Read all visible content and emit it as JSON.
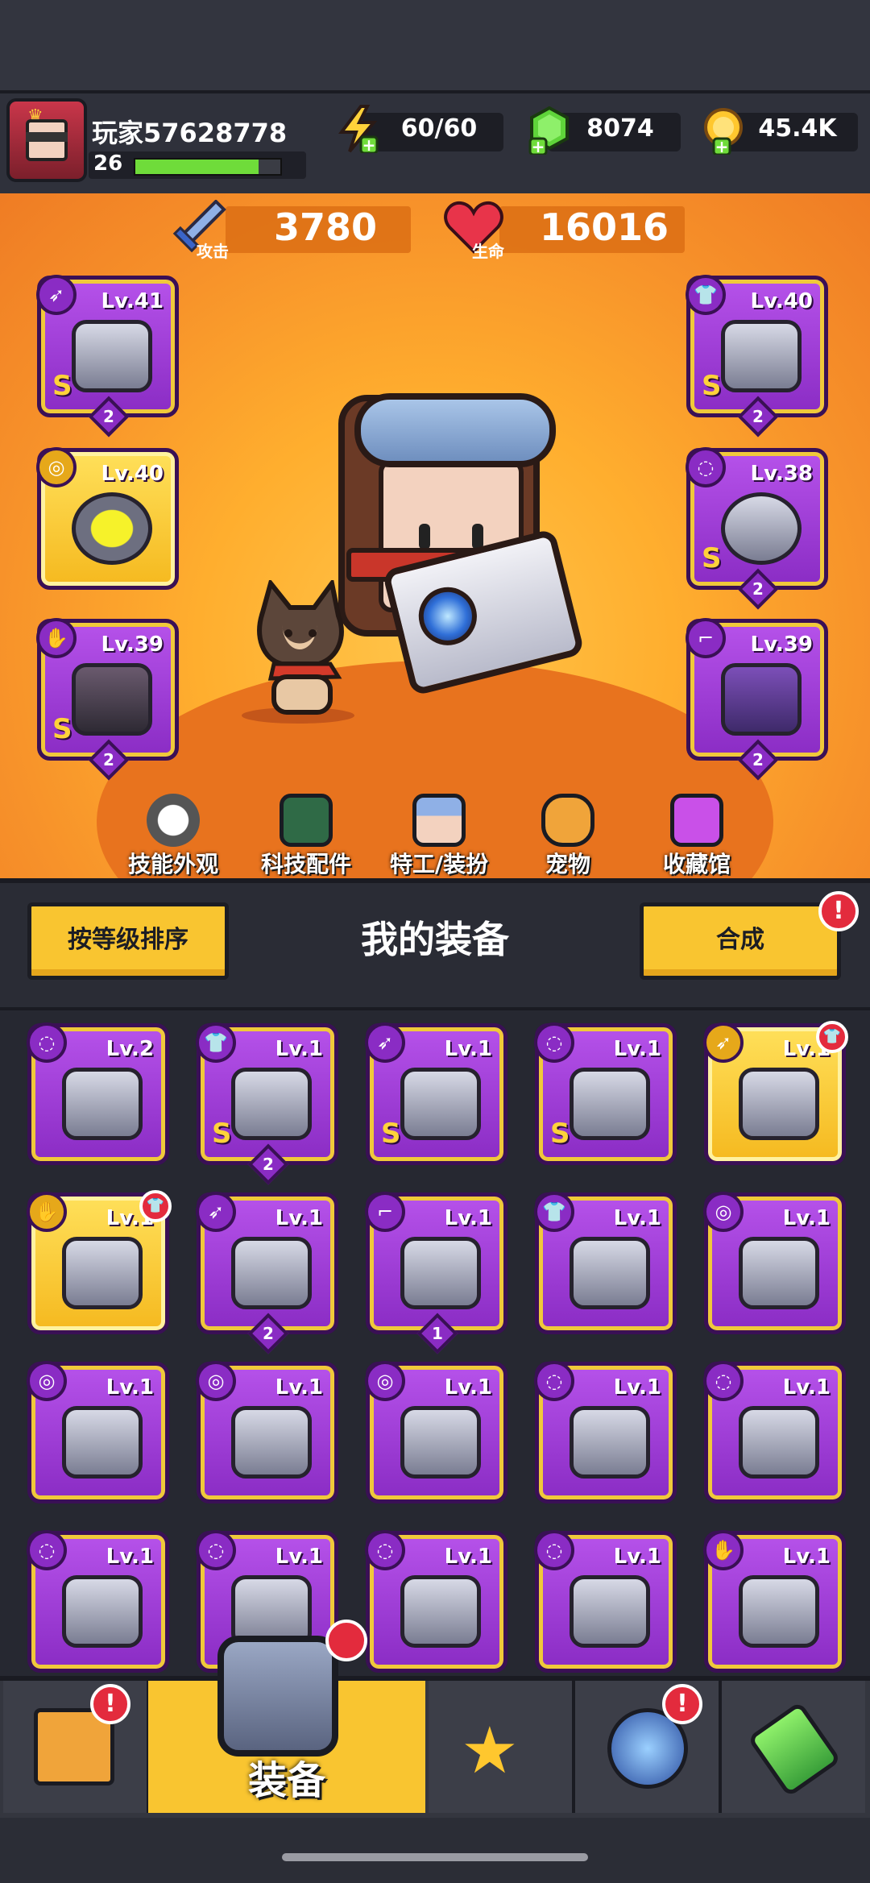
{
  "header": {
    "player_name": "玩家57628778",
    "player_level": "26",
    "xp_progress": 0.85,
    "energy": "60/60",
    "gems": "8074",
    "coins": "45.4K"
  },
  "stats": {
    "attack_value": "3780",
    "attack_label": "攻击",
    "hp_value": "16016",
    "hp_label": "生命"
  },
  "equipped": [
    {
      "slot": "weapon",
      "icon": "gun-icon",
      "level": "Lv.41",
      "rank": "S",
      "count": "2",
      "rarity": "purple"
    },
    {
      "slot": "necklace",
      "icon": "spiked-collar-icon",
      "level": "Lv.40",
      "rank": "",
      "count": "",
      "rarity": "gold"
    },
    {
      "slot": "gloves",
      "icon": "gauntlet-icon",
      "level": "Lv.39",
      "rank": "S",
      "count": "2",
      "rarity": "purple"
    },
    {
      "slot": "armor",
      "icon": "armor-icon",
      "level": "Lv.40",
      "rank": "S",
      "count": "2",
      "rarity": "purple"
    },
    {
      "slot": "belt",
      "icon": "belt-icon",
      "level": "Lv.38",
      "rank": "S",
      "count": "2",
      "rarity": "purple"
    },
    {
      "slot": "boots",
      "icon": "boots-icon",
      "level": "Lv.39",
      "rank": "",
      "count": "2",
      "rarity": "purple"
    }
  ],
  "features": [
    {
      "label": "技能外观",
      "icon": "skill-skin-icon"
    },
    {
      "label": "科技配件",
      "icon": "tech-parts-icon"
    },
    {
      "label": "特工/装扮",
      "icon": "agent-icon"
    },
    {
      "label": "宠物",
      "icon": "pet-icon"
    },
    {
      "label": "收藏馆",
      "icon": "collection-icon"
    }
  ],
  "inventory_header": {
    "sort_label": "按等级排序",
    "title": "我的装备",
    "merge_label": "合成",
    "alert": "!"
  },
  "inventory": [
    {
      "icon": "belt-icon",
      "level": "Lv.2",
      "rank": "",
      "count": "",
      "rarity": "purple",
      "new": false
    },
    {
      "icon": "armor-icon",
      "level": "Lv.1",
      "rank": "S",
      "count": "2",
      "rarity": "purple",
      "new": false
    },
    {
      "icon": "sword-icon",
      "level": "Lv.1",
      "rank": "S",
      "count": "",
      "rarity": "purple",
      "new": false
    },
    {
      "icon": "belt-icon",
      "level": "Lv.1",
      "rank": "S",
      "count": "",
      "rarity": "purple",
      "new": false
    },
    {
      "icon": "kunai-icon",
      "level": "Lv.1",
      "rank": "",
      "count": "",
      "rarity": "gold",
      "new": true
    },
    {
      "icon": "gauntlet-icon",
      "level": "Lv.1",
      "rank": "",
      "count": "",
      "rarity": "gold",
      "new": true
    },
    {
      "icon": "kunai-icon",
      "level": "Lv.1",
      "rank": "",
      "count": "2",
      "rarity": "purple",
      "new": false
    },
    {
      "icon": "boots-icon",
      "level": "Lv.1",
      "rank": "",
      "count": "1",
      "rarity": "purple",
      "new": false
    },
    {
      "icon": "armor-icon",
      "level": "Lv.1",
      "rank": "",
      "count": "",
      "rarity": "purple",
      "new": false
    },
    {
      "icon": "necklace-icon",
      "level": "Lv.1",
      "rank": "",
      "count": "",
      "rarity": "purple",
      "new": false
    },
    {
      "icon": "necklace-icon",
      "level": "Lv.1",
      "rank": "",
      "count": "",
      "rarity": "purple",
      "new": false
    },
    {
      "icon": "necklace-icon",
      "level": "Lv.1",
      "rank": "",
      "count": "",
      "rarity": "purple",
      "new": false
    },
    {
      "icon": "necklace-icon",
      "level": "Lv.1",
      "rank": "",
      "count": "",
      "rarity": "purple",
      "new": false
    },
    {
      "icon": "belt-icon",
      "level": "Lv.1",
      "rank": "",
      "count": "",
      "rarity": "purple",
      "new": false
    },
    {
      "icon": "belt-icon",
      "level": "Lv.1",
      "rank": "",
      "count": "",
      "rarity": "purple",
      "new": false
    },
    {
      "icon": "belt-icon",
      "level": "Lv.1",
      "rank": "",
      "count": "",
      "rarity": "purple",
      "new": false
    },
    {
      "icon": "belt-icon",
      "level": "Lv.1",
      "rank": "",
      "count": "",
      "rarity": "purple",
      "new": false
    },
    {
      "icon": "belt-icon",
      "level": "Lv.1",
      "rank": "",
      "count": "",
      "rarity": "purple",
      "new": false
    },
    {
      "icon": "belt-icon",
      "level": "Lv.1",
      "rank": "",
      "count": "",
      "rarity": "purple",
      "new": false
    },
    {
      "icon": "gauntlet-icon",
      "level": "Lv.1",
      "rank": "",
      "count": "",
      "rarity": "purple",
      "new": false
    }
  ],
  "nav": {
    "equip_label": "装备",
    "items": [
      {
        "icon": "shop-icon",
        "alert": "!"
      },
      {
        "icon": "equipment-icon",
        "alert": ""
      },
      {
        "icon": "battle-icon",
        "alert": ""
      },
      {
        "icon": "challenge-icon",
        "alert": "!"
      },
      {
        "icon": "research-icon",
        "alert": ""
      }
    ]
  },
  "colors": {
    "accent_yellow": "#f9c530",
    "purple_rarity": "#a542dc",
    "gold_rarity": "#f5c02a",
    "alert_red": "#e32b3d"
  }
}
